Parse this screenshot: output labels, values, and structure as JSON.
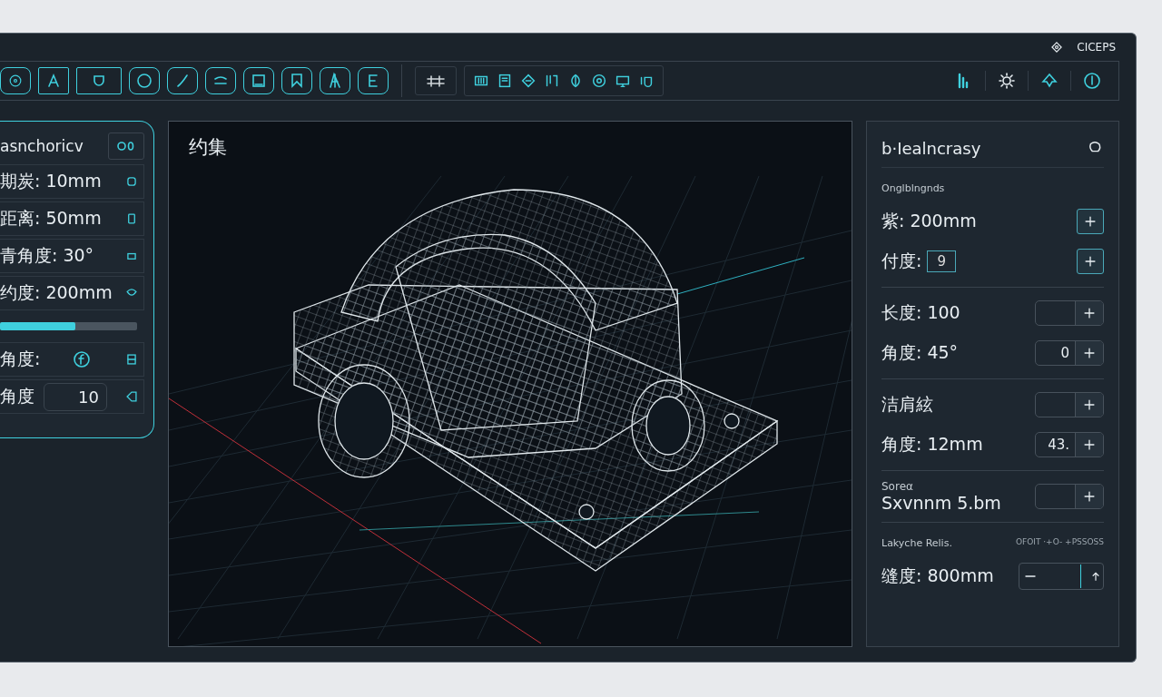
{
  "title_bar": {
    "label": "CICEPS"
  },
  "left_panel": {
    "title": "asnchoricv",
    "rows": [
      {
        "kind": "value",
        "label": "期炭: 10mm"
      },
      {
        "kind": "value",
        "label": "距离: 50mm"
      },
      {
        "kind": "value",
        "label": "青角度: 30°"
      },
      {
        "kind": "value",
        "label": "约度: 200mm"
      },
      {
        "kind": "slider",
        "level": 0.55
      },
      {
        "kind": "value",
        "label": "角度:"
      },
      {
        "kind": "field",
        "label": "角度",
        "value": "10"
      }
    ]
  },
  "viewport": {
    "title": "约集"
  },
  "right_panel": {
    "title": "b·Iealncrasy",
    "sections": [
      {
        "heading": "Onglblngnds",
        "rows": [
          {
            "kind": "button",
            "label": "紫: 200mm"
          },
          {
            "kind": "inline",
            "label": "付度:",
            "value": "9"
          }
        ]
      },
      {
        "rows": [
          {
            "kind": "stepper",
            "label": "长度: 100"
          },
          {
            "kind": "stepper",
            "label": "角度: 45°",
            "value": "0"
          }
        ]
      },
      {
        "rows": [
          {
            "kind": "stepper",
            "label": "洁肩絃"
          },
          {
            "kind": "stepper",
            "label": "角度: 12mm",
            "value": "43."
          }
        ]
      },
      {
        "rows": [
          {
            "kind": "stepper",
            "caption": "Soreα",
            "label": "Sxvnnm 5.bm"
          }
        ]
      },
      {
        "heading": "Lakyche Relis.",
        "note": "OFOIT ·+O- +PSSOSS",
        "rows": [
          {
            "kind": "range",
            "label": "缝度: 800mm"
          }
        ]
      }
    ]
  }
}
